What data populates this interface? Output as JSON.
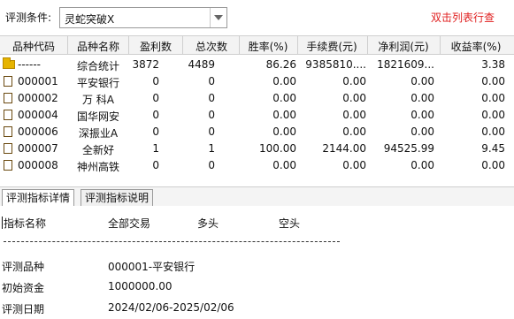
{
  "toolbar": {
    "condition_label": "评测条件:",
    "condition_value": "灵蛇突破X",
    "hint": "双击列表行查"
  },
  "table": {
    "headers": [
      "品种代码",
      "品种名称",
      "盈利数",
      "总次数",
      "胜率(%)",
      "手续费(元)",
      "净利润(元)",
      "收益率(%)"
    ],
    "rows": [
      {
        "icon": "folder-icon",
        "code": "------",
        "name": "综合统计",
        "profit_count": "3872",
        "total": "4489",
        "win_rate": "86.26",
        "fee": "9385810....",
        "net_profit": "1821609...",
        "return_rate": "3.38"
      },
      {
        "icon": "document-icon",
        "code": "000001",
        "name": "平安银行",
        "profit_count": "0",
        "total": "0",
        "win_rate": "0.00",
        "fee": "0.00",
        "net_profit": "0.00",
        "return_rate": "0.00"
      },
      {
        "icon": "document-icon",
        "code": "000002",
        "name": "万 科A",
        "profit_count": "0",
        "total": "0",
        "win_rate": "0.00",
        "fee": "0.00",
        "net_profit": "0.00",
        "return_rate": "0.00"
      },
      {
        "icon": "document-icon",
        "code": "000004",
        "name": "国华网安",
        "profit_count": "0",
        "total": "0",
        "win_rate": "0.00",
        "fee": "0.00",
        "net_profit": "0.00",
        "return_rate": "0.00"
      },
      {
        "icon": "document-icon",
        "code": "000006",
        "name": "深振业A",
        "profit_count": "0",
        "total": "0",
        "win_rate": "0.00",
        "fee": "0.00",
        "net_profit": "0.00",
        "return_rate": "0.00"
      },
      {
        "icon": "document-icon",
        "code": "000007",
        "name": "全新好",
        "profit_count": "1",
        "total": "1",
        "win_rate": "100.00",
        "fee": "2144.00",
        "net_profit": "94525.99",
        "return_rate": "9.45"
      },
      {
        "icon": "document-icon",
        "code": "000008",
        "name": "神州高铁",
        "profit_count": "0",
        "total": "0",
        "win_rate": "0.00",
        "fee": "0.00",
        "net_profit": "0.00",
        "return_rate": "0.00"
      }
    ]
  },
  "tabs": [
    {
      "label": "评测指标详情",
      "active": true
    },
    {
      "label": "评测指标说明",
      "active": false
    }
  ],
  "detail": {
    "header": {
      "col1": "指标名称",
      "col2": "全部交易",
      "col3": "多头",
      "col4": "空头"
    },
    "items": [
      {
        "label": "评测品种",
        "value": "000001-平安银行"
      },
      {
        "label": "初始资金",
        "value": "1000000.00"
      },
      {
        "label": "评测日期",
        "value": "2024/02/06-2025/02/06"
      }
    ]
  }
}
